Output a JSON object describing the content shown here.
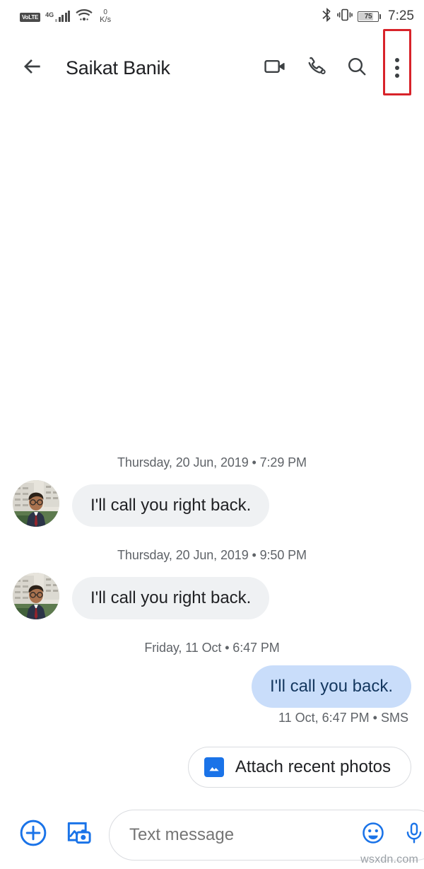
{
  "status_bar": {
    "volte_label": "VoLTE",
    "network_type": "4G",
    "wifi_icon": "wifi-icon",
    "data_speed_value": "0",
    "data_speed_unit": "K/s",
    "bluetooth_icon": "bluetooth-icon",
    "vibrate_icon": "vibrate-icon",
    "battery_level": "75",
    "time": "7:25"
  },
  "app_bar": {
    "back_icon": "back-arrow-icon",
    "title": "Saikat Banik",
    "video_call_icon": "video-call-icon",
    "voice_call_icon": "phone-call-icon",
    "search_icon": "search-icon",
    "overflow_icon": "more-vert-icon",
    "highlight_color": "#d8232a"
  },
  "thread": {
    "entries": [
      {
        "separator": "Thursday, 20 Jun, 2019 • 7:29 PM",
        "text": "I'll call you right back.",
        "direction": "in"
      },
      {
        "separator": "Thursday, 20 Jun, 2019 • 9:50 PM",
        "text": "I'll call you right back.",
        "direction": "in"
      },
      {
        "separator": "Friday, 11 Oct • 6:47 PM",
        "text": "I'll call you back.",
        "direction": "out",
        "status": "11 Oct, 6:47 PM • SMS"
      }
    ],
    "suggestion_chip": {
      "label": "Attach recent photos",
      "icon": "image-icon",
      "icon_color": "#1a73e8"
    },
    "bubble_in_color": "#eff1f3",
    "bubble_out_color": "#c9ddfa"
  },
  "composer": {
    "add_icon": "plus-circle-icon",
    "gallery_icon": "gallery-camera-icon",
    "input_placeholder": "Text message",
    "input_value": "",
    "emoji_icon": "emoji-icon",
    "mic_icon": "microphone-icon",
    "accent_color": "#1a73e8"
  },
  "watermark": "wsxdn.com"
}
